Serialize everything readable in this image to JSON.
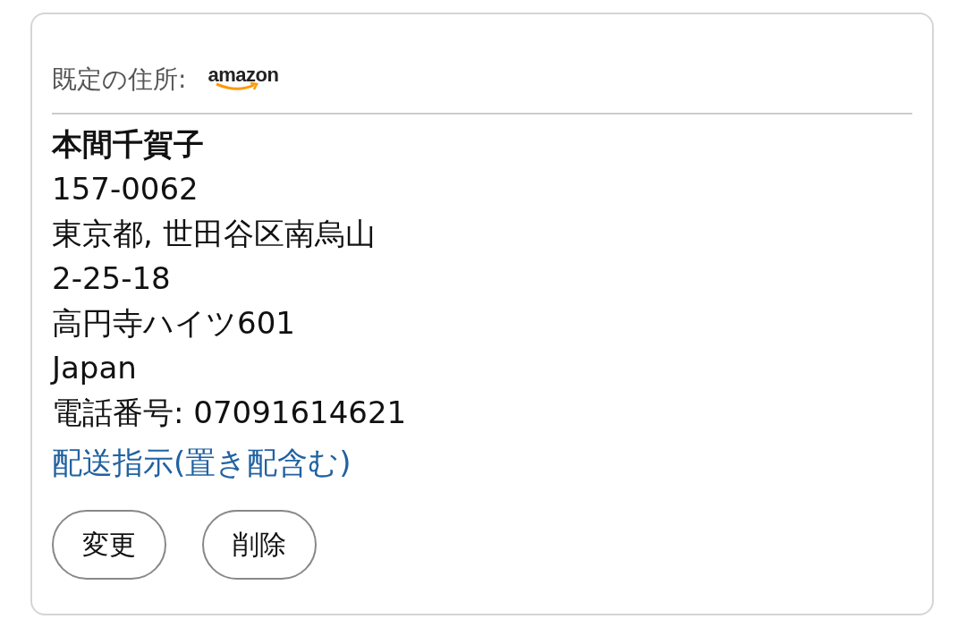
{
  "header": {
    "label": "既定の住所:",
    "logo_text": "amazon"
  },
  "address": {
    "name": "本間千賀子",
    "lines": [
      "157-0062",
      "東京都, 世田谷区南烏山",
      "2-25-18",
      "高円寺ハイツ601",
      "Japan",
      "電話番号: 07091614621"
    ]
  },
  "link": "配送指示(置き配含む)",
  "buttons": [
    "変更",
    "削除"
  ]
}
